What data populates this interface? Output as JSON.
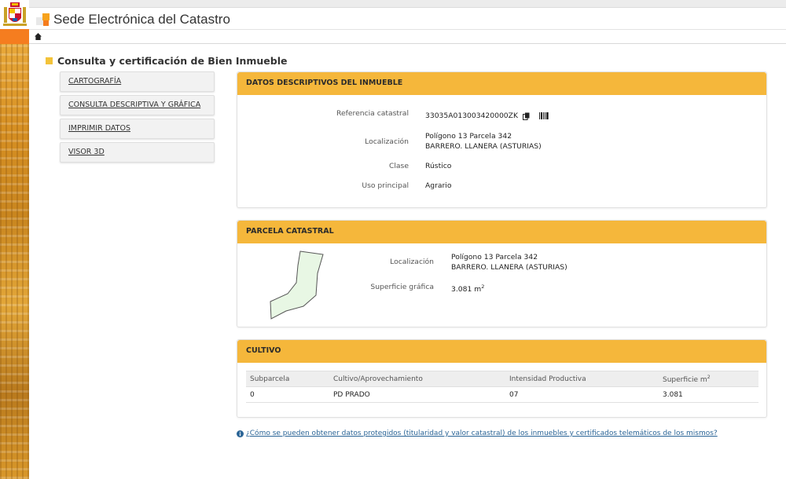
{
  "header": {
    "site_title": "Sede Electrónica del Catastro"
  },
  "page": {
    "heading": "Consulta y certificación de Bien Inmueble"
  },
  "side_menu": {
    "items": [
      {
        "label": "CARTOGRAFÍA"
      },
      {
        "label": "CONSULTA DESCRIPTIVA Y GRÁFICA"
      },
      {
        "label": "IMPRIMIR DATOS"
      },
      {
        "label": "VISOR 3D"
      }
    ]
  },
  "datos": {
    "title": "DATOS DESCRIPTIVOS DEL INMUEBLE",
    "ref_label": "Referencia catastral",
    "ref_value": "33035A013003420000ZK",
    "loc_label": "Localización",
    "loc_line1": "Polígono 13 Parcela 342",
    "loc_line2": "BARRERO. LLANERA (ASTURIAS)",
    "clase_label": "Clase",
    "clase_value": "Rústico",
    "uso_label": "Uso principal",
    "uso_value": "Agrario"
  },
  "parcela": {
    "title": "PARCELA CATASTRAL",
    "loc_label": "Localización",
    "loc_line1": "Polígono 13 Parcela 342",
    "loc_line2": "BARRERO. LLANERA (ASTURIAS)",
    "sup_label": "Superficie gráfica",
    "sup_value": "3.081 m",
    "sup_exp": "2"
  },
  "cultivo": {
    "title": "CULTIVO",
    "headers": [
      "Subparcela",
      "Cultivo/Aprovechamiento",
      "Intensidad Productiva",
      "Superficie m"
    ],
    "header_sup_exp": "2",
    "rows": [
      [
        "0",
        "PD PRADO",
        "07",
        "3.081"
      ]
    ]
  },
  "footer": {
    "help_link": "¿Cómo se pueden obtener datos protegidos (titularidad y valor catastral) de los inmuebles y certificados telemáticos de los mismos?"
  },
  "colors": {
    "accent": "#f5b73b",
    "brand_orange": "#f57d1f",
    "link": "#2a6496"
  }
}
